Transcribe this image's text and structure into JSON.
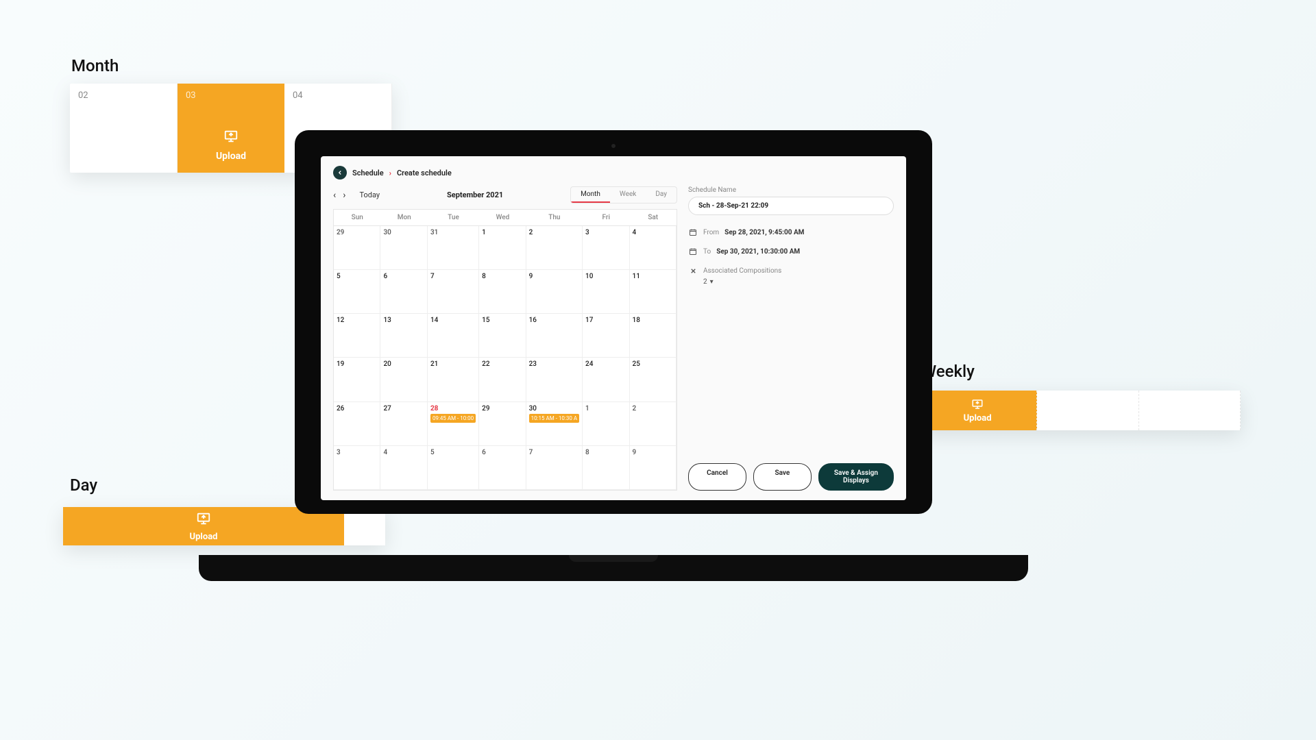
{
  "breadcrumb": {
    "schedule": "Schedule",
    "create": "Create schedule"
  },
  "calendar": {
    "title": "September 2021",
    "today_label": "Today",
    "tabs": {
      "month": "Month",
      "week": "Week",
      "day": "Day"
    },
    "weekdays": [
      "Sun",
      "Mon",
      "Tue",
      "Wed",
      "Thu",
      "Fri",
      "Sat"
    ],
    "grid": [
      [
        {
          "n": "29",
          "out": true
        },
        {
          "n": "30",
          "out": true
        },
        {
          "n": "31",
          "out": true
        },
        {
          "n": "1"
        },
        {
          "n": "2"
        },
        {
          "n": "3"
        },
        {
          "n": "4"
        }
      ],
      [
        {
          "n": "5"
        },
        {
          "n": "6"
        },
        {
          "n": "7"
        },
        {
          "n": "8"
        },
        {
          "n": "9"
        },
        {
          "n": "10"
        },
        {
          "n": "11"
        }
      ],
      [
        {
          "n": "12"
        },
        {
          "n": "13"
        },
        {
          "n": "14"
        },
        {
          "n": "15"
        },
        {
          "n": "16"
        },
        {
          "n": "17"
        },
        {
          "n": "18"
        }
      ],
      [
        {
          "n": "19"
        },
        {
          "n": "20"
        },
        {
          "n": "21"
        },
        {
          "n": "22"
        },
        {
          "n": "23"
        },
        {
          "n": "24"
        },
        {
          "n": "25"
        }
      ],
      [
        {
          "n": "26"
        },
        {
          "n": "27"
        },
        {
          "n": "28",
          "hl": true,
          "event": "09:45 AM - 10:00"
        },
        {
          "n": "29"
        },
        {
          "n": "30",
          "event": "10:15 AM - 10:30 A"
        },
        {
          "n": "1",
          "out": true
        },
        {
          "n": "2",
          "out": true
        }
      ],
      [
        {
          "n": "3",
          "out": true
        },
        {
          "n": "4",
          "out": true
        },
        {
          "n": "5",
          "out": true
        },
        {
          "n": "6",
          "out": true
        },
        {
          "n": "7",
          "out": true
        },
        {
          "n": "8",
          "out": true
        },
        {
          "n": "9",
          "out": true
        }
      ]
    ]
  },
  "sidebar": {
    "schedule_name_label": "Schedule Name",
    "schedule_name": "Sch - 28-Sep-21 22:09",
    "from_label": "From",
    "from_value": "Sep 28, 2021, 9:45:00 AM",
    "to_label": "To",
    "to_value": "Sep 30, 2021, 10:30:00 AM",
    "assoc_label": "Associated Compositions",
    "assoc_count": "2",
    "cancel": "Cancel",
    "save": "Save",
    "save_assign": "Save & Assign Displays"
  },
  "callouts": {
    "month": {
      "title": "Month",
      "cells": [
        "02",
        "03",
        "04"
      ],
      "upload": "Upload"
    },
    "day": {
      "title": "Day",
      "upload": "Upload"
    },
    "weekly": {
      "title": "Weekly",
      "upload": "Upload"
    }
  }
}
